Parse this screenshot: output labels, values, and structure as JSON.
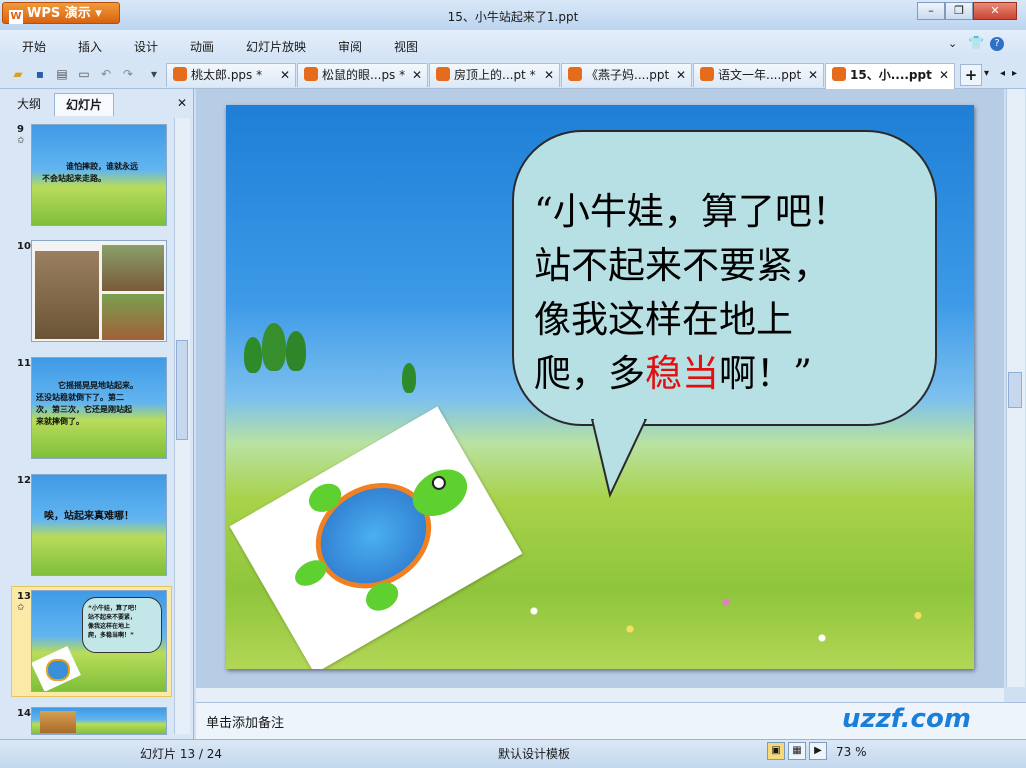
{
  "app": {
    "name": "WPS 演示",
    "logo_letter": "W",
    "window_title": "15、小牛站起来了1.ppt"
  },
  "window_controls": {
    "minimize": "–",
    "restore": "❐",
    "close": "✕"
  },
  "menu": [
    "开始",
    "插入",
    "设计",
    "动画",
    "幻灯片放映",
    "审阅",
    "视图"
  ],
  "menu_right": {
    "expand_icon": "chevron-down-icon",
    "skin_icon": "shirt-icon",
    "help": "?"
  },
  "quick_access": [
    "open-icon",
    "save-icon",
    "print-icon",
    "print-preview-icon",
    "undo-icon",
    "redo-icon",
    "customize-icon"
  ],
  "doc_tabs": [
    {
      "label": "桃太郎.pps *",
      "active": false
    },
    {
      "label": "松鼠的眼...ps *",
      "active": false
    },
    {
      "label": "房顶上的...pt *",
      "active": false
    },
    {
      "label": "《燕子妈....ppt",
      "active": false
    },
    {
      "label": "语文一年....ppt",
      "active": false
    },
    {
      "label": "15、小....ppt",
      "active": true
    }
  ],
  "tab_close": "✕",
  "new_tab": "+",
  "left_pane": {
    "tabs": [
      "大纲",
      "幻灯片"
    ],
    "close": "✕"
  },
  "thumbnails": [
    {
      "num": "9",
      "star": "✩",
      "lines": [
        "谁怕摔跤，谁就永远",
        "不会站起来走路。"
      ]
    },
    {
      "num": "10",
      "star": "",
      "lines": []
    },
    {
      "num": "11",
      "star": "",
      "lines": [
        "它摇摇晃晃地站起来。",
        "还没站稳就倒下了。第二",
        "次，第三次，它还是刚站起",
        "来就摔倒了。"
      ]
    },
    {
      "num": "12",
      "star": "",
      "lines": [
        "唉，站起来真难哪！"
      ]
    },
    {
      "num": "13",
      "star": "✩",
      "lines": [
        "“小牛娃，算了吧！",
        "站不起来不要紧，",
        "像我这样在地上",
        "爬，多稳当啊！”"
      ]
    },
    {
      "num": "14",
      "star": "",
      "lines": []
    }
  ],
  "slide": {
    "line1": "“小牛娃，算了吧！",
    "line2": "站不起来不要紧，",
    "line3": "像我这样在地上",
    "line4_a": "爬，多",
    "line4_red": "稳当",
    "line4_b": "啊！”"
  },
  "notes_placeholder": "单击添加备注",
  "status": {
    "slide_counter": "幻灯片 13 / 24",
    "template": "默认设计模板",
    "zoom": "73 %"
  },
  "watermark": "uzzf.com"
}
